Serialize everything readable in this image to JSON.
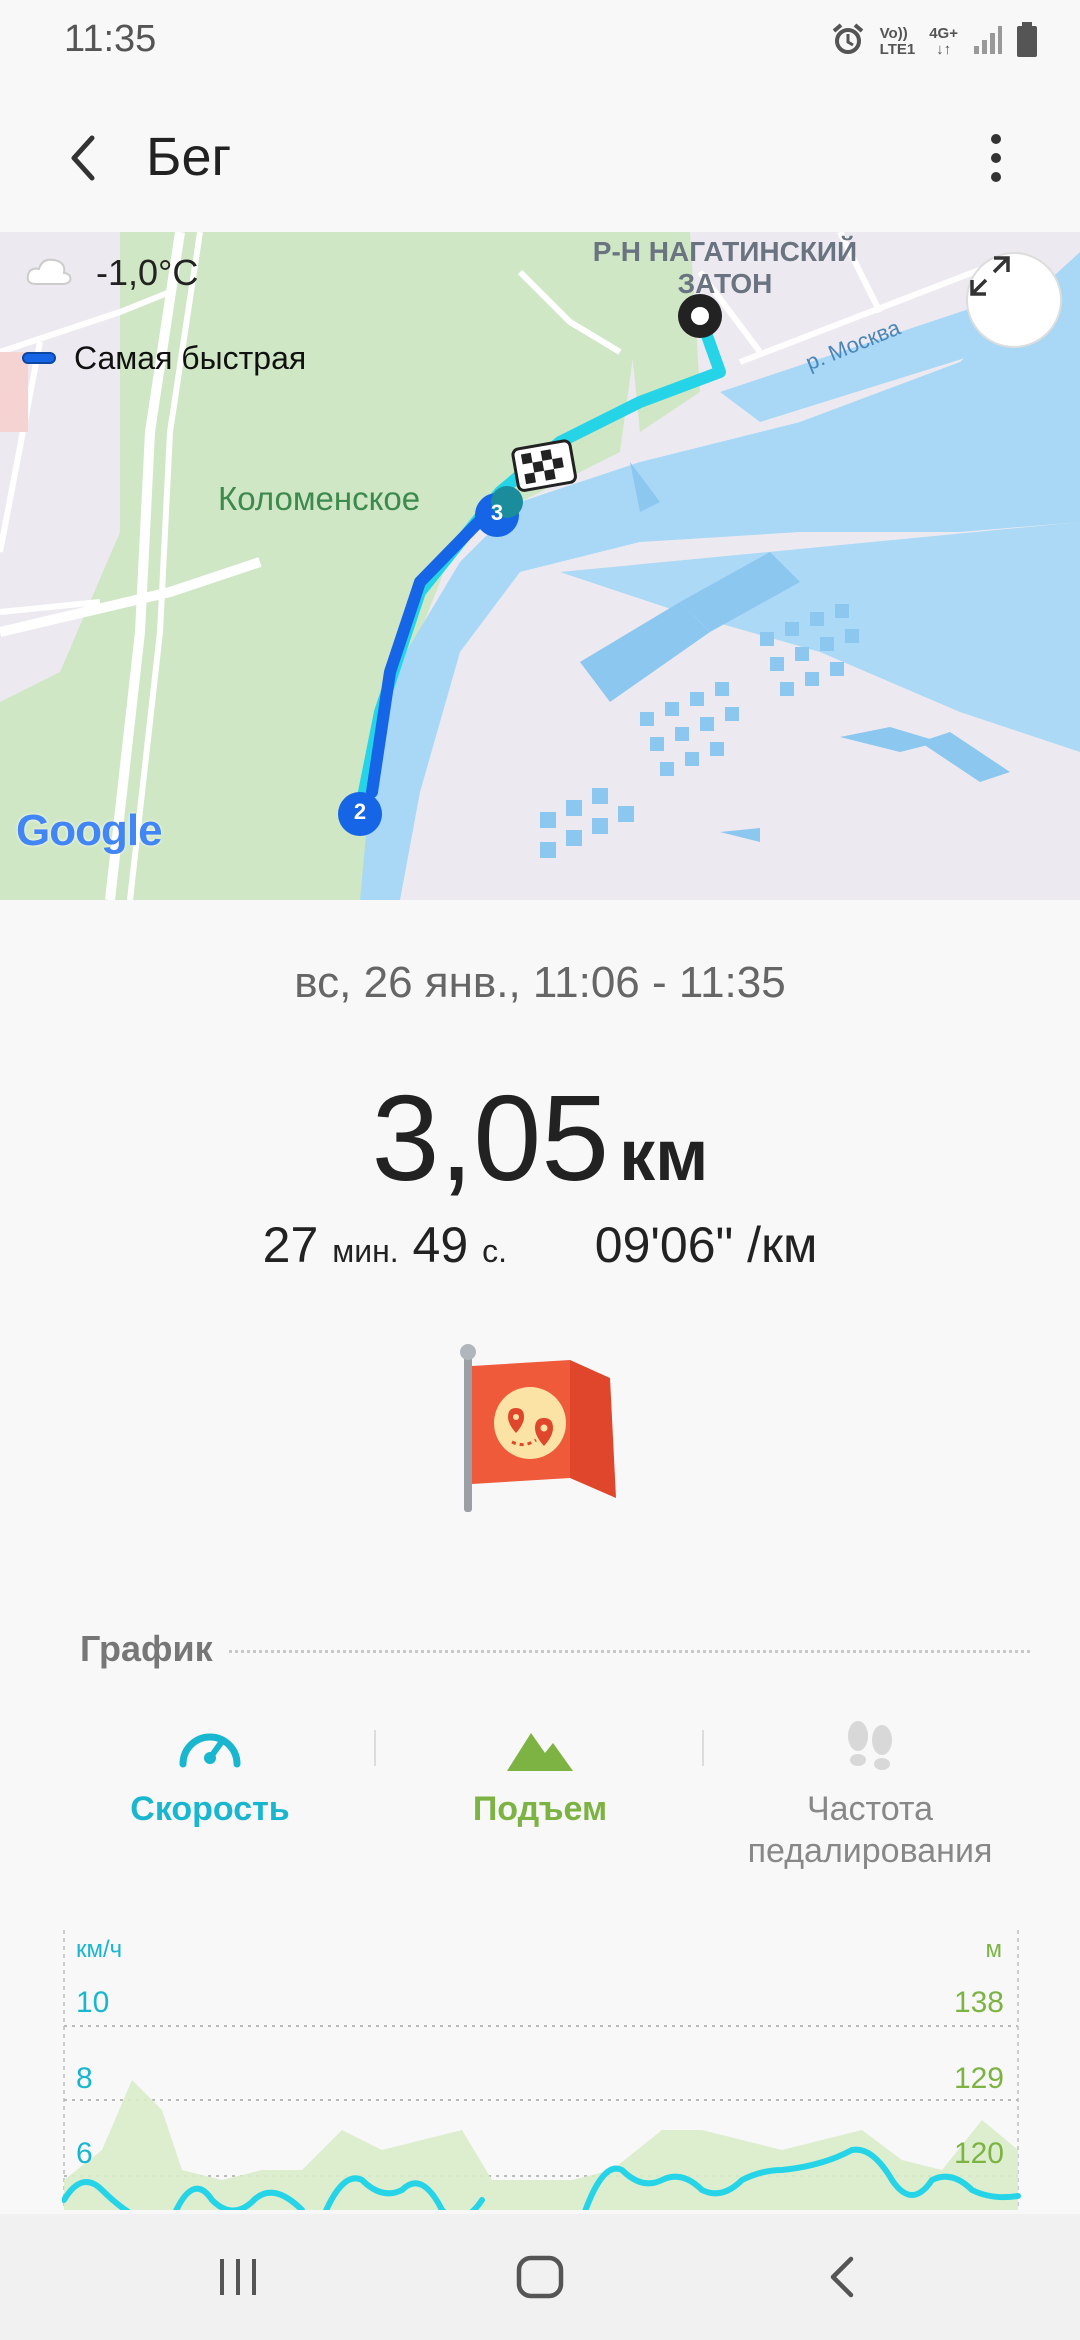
{
  "status_bar": {
    "time": "11:35",
    "volte_label_top": "Vo))",
    "volte_label_bottom": "LTE1",
    "network_label": "4G+"
  },
  "header": {
    "title": "Бег"
  },
  "map": {
    "weather_temp": "-1,0°C",
    "legend_label": "Самая быстрая",
    "district_label_line1": "Р-Н НАГАТИНСКИЙ",
    "district_label_line2": "ЗАТОН",
    "park_label": "Коломенское",
    "river_label": "р. Москва",
    "marker_2": "2",
    "marker_3": "3",
    "google_logo": "Google",
    "route_color_fast": "#1565e6",
    "route_color_main": "#26d4e8"
  },
  "summary": {
    "date_range": "вс, 26 янв., 11:06 - 11:35",
    "distance_value": "3,05",
    "distance_unit": "км",
    "duration_min": "27",
    "duration_min_unit": "мин.",
    "duration_sec": "49",
    "duration_sec_unit": "с.",
    "pace": "09'06\" /км"
  },
  "graph": {
    "title": "График",
    "tabs": [
      {
        "label": "Скорость",
        "color": "#19b6d0"
      },
      {
        "label": "Подъем",
        "color": "#7cb342"
      },
      {
        "label": "Частота педалирования",
        "color": "#888888"
      }
    ],
    "left_unit": "км/ч",
    "right_unit": "м",
    "left_ticks": [
      "10",
      "8",
      "6"
    ],
    "right_ticks": [
      "138",
      "129",
      "120"
    ]
  }
}
